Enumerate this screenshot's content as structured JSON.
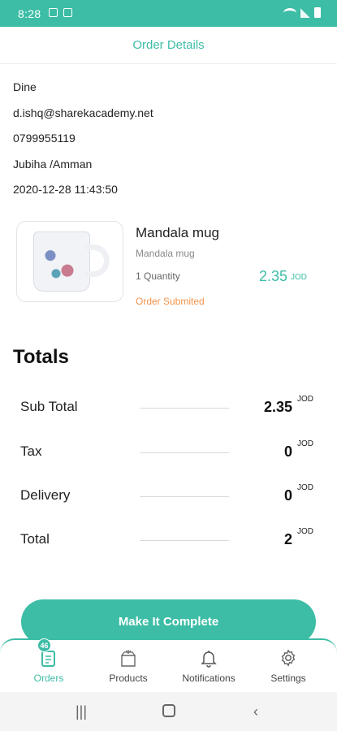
{
  "status_bar": {
    "time": "8:28"
  },
  "header": {
    "title": "Order Details"
  },
  "customer": {
    "name": "Dine",
    "email": "d.ishq@sharekacademy.net",
    "phone": "0799955119",
    "address": "Jubiha /Amman",
    "datetime": "2020-12-28 11:43:50"
  },
  "product": {
    "name": "Mandala mug",
    "description": "Mandala mug",
    "quantity": "1 Quantity",
    "price": "2.35",
    "currency": "JOD",
    "status": "Order Submited"
  },
  "totals": {
    "title": "Totals",
    "rows": [
      {
        "label": "Sub Total",
        "value": "2.35",
        "currency": "JOD"
      },
      {
        "label": "Tax",
        "value": "0",
        "currency": "JOD"
      },
      {
        "label": "Delivery",
        "value": "0",
        "currency": "JOD"
      },
      {
        "label": "Total",
        "value": "2",
        "currency": "JOD"
      }
    ]
  },
  "action": {
    "complete_label": "Make It Complete"
  },
  "bottom_nav": {
    "items": [
      {
        "label": "Orders",
        "badge": "46",
        "icon": "orders-icon"
      },
      {
        "label": "Products",
        "icon": "box-icon"
      },
      {
        "label": "Notifications",
        "icon": "bell-icon"
      },
      {
        "label": "Settings",
        "icon": "gear-icon"
      }
    ]
  },
  "colors": {
    "accent": "#3dbda6",
    "status_orange": "#f2934a"
  }
}
